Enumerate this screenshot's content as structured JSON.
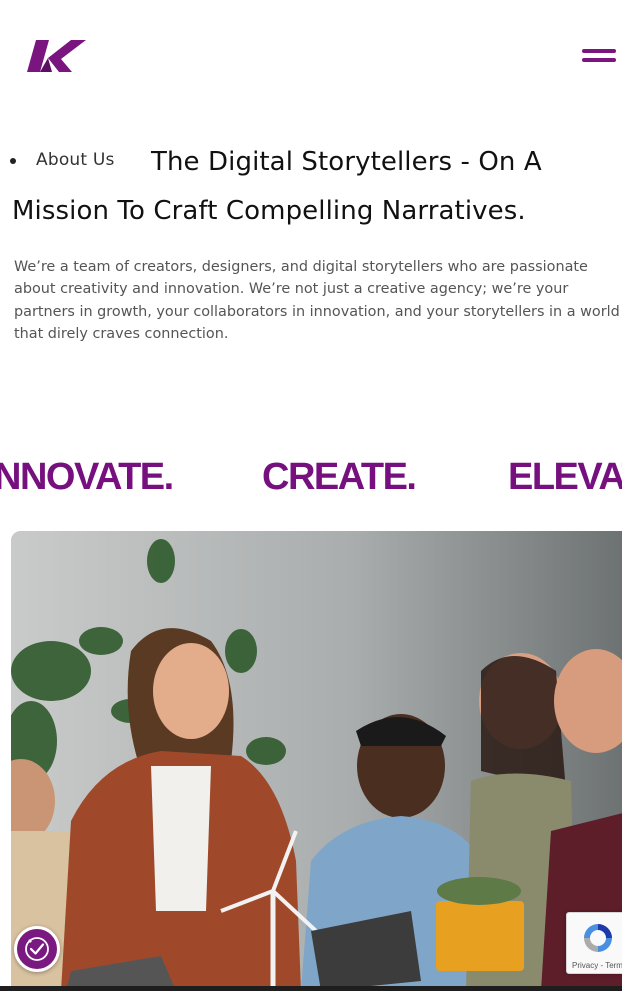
{
  "header": {
    "logo_icon": "k-logo-icon",
    "menu_icon": "hamburger-menu-icon",
    "brand_color": "#7a1580"
  },
  "section": {
    "nav_item": "About Us",
    "headline": "The Digital Storytellers - On A Mission To Craft Compelling Narratives.",
    "intro": "We’re a team of creators, designers, and digital storytellers who are passionate about creativity and innovation. We’re not just a creative agency; we’re your partners in growth, your collaborators in innovation, and your storytellers in a world that direly craves connection."
  },
  "marquee": {
    "words": [
      "NNOVATE.",
      "CREATE.",
      "ELEVAT"
    ],
    "color": "#76107f"
  },
  "photo": {
    "subject": "team-photo"
  },
  "widgets": {
    "accessibility_icon": "accessibility-icon",
    "recaptcha_links": "Privacy - Terms"
  }
}
